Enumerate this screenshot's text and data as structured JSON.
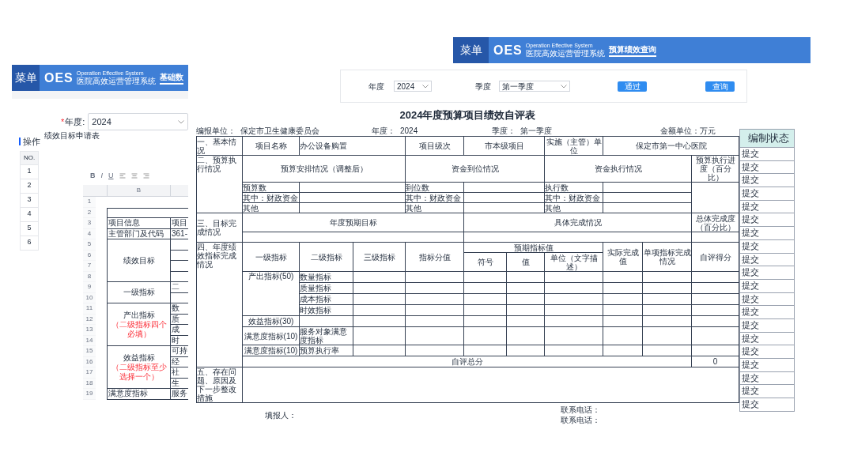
{
  "left_window": {
    "menu": "菜单",
    "logo": "OES",
    "logo_en": "Operation Effective System",
    "logo_cn": "医院高效运营管理系统",
    "tabs": [
      {
        "label": "基础数",
        "selected": true
      }
    ],
    "year_field": {
      "required_mark": "*",
      "label": "年度:",
      "value": "2024"
    },
    "section_title": "操作",
    "table": {
      "columns": [
        "NO."
      ],
      "rows": [
        "1",
        "2",
        "3",
        "4",
        "5",
        "6"
      ]
    }
  },
  "dialog": {
    "title": "绩效目标申请表",
    "toolbar": [
      "B",
      "I",
      "U"
    ],
    "sheet": {
      "column_header": "B",
      "row_numbers": [
        "1",
        "2",
        "3",
        "4",
        "5",
        "6",
        "7",
        "8",
        "9",
        "10",
        "11",
        "12",
        "13",
        "14",
        "15",
        "16",
        "17",
        "18",
        "19"
      ],
      "blocks": [
        {
          "label": "项目信息",
          "items": [
            {
              "text": "项目"
            }
          ]
        },
        {
          "label": "主管部门及代码",
          "items": [
            {
              "text": "361-"
            }
          ]
        },
        {
          "label": "绩效目标",
          "items": [
            {
              "kind": "blank"
            },
            {
              "kind": "blank"
            },
            {
              "kind": "blank"
            },
            {
              "kind": "blank"
            }
          ]
        },
        {
          "label": "一级指标",
          "items": [
            {
              "text": "二"
            },
            {
              "kind": "blank"
            }
          ]
        },
        {
          "label": "产出指标",
          "note": "（二级指标四个必填）",
          "items": [
            {
              "text": "数"
            },
            {
              "text": "质"
            },
            {
              "text": "成"
            },
            {
              "text": "时"
            }
          ]
        },
        {
          "label": "效益指标",
          "note": "（二级指标至少选择一个）",
          "items": [
            {
              "text": "可持"
            },
            {
              "text": "经"
            },
            {
              "text": "社"
            },
            {
              "text": "生"
            }
          ]
        },
        {
          "label": "满意度指标",
          "items": [
            {
              "text": "服务"
            }
          ]
        }
      ]
    }
  },
  "top_window": {
    "menu": "菜单",
    "logo": "OES",
    "logo_en": "Operation Effective System",
    "logo_cn": "医院高效运营管理系统",
    "tabs": [
      {
        "label": "预算绩效查询",
        "selected": true
      }
    ]
  },
  "filter": {
    "year_label": "年度",
    "year_value": "2024",
    "quarter_label": "季度",
    "quarter_value": "第一季度",
    "buttons": [
      "通过",
      "查询"
    ]
  },
  "form": {
    "title": "2024年度预算项目绩效自评表",
    "meta": [
      {
        "label": "编报单位：",
        "value": "保定市卫生健康委员会"
      },
      {
        "label": "年度：",
        "value": "2024"
      },
      {
        "label": "季度：",
        "value": "第一季度"
      },
      {
        "label": "金额单位：万元"
      }
    ],
    "rows": [
      [
        {
          "text": "一、基本情况"
        },
        {
          "text": "项目名称"
        },
        {
          "text": "办公设备购置",
          "colspan": 2
        },
        {
          "text": "项目级次"
        },
        {
          "text": "市本级项目",
          "colspan": 2
        },
        {
          "text": "实施（主管）单位"
        },
        {
          "text": "保定市第一中心医院",
          "colspan": 3
        }
      ],
      [
        {
          "text": "二、预算执行情况",
          "rowspan": 4
        },
        {
          "text": "预算安排情况（调整后）",
          "colspan": 3
        },
        {
          "text": "资金到位情况",
          "colspan": 3
        },
        {
          "text": "资金执行情况",
          "colspan": 3
        },
        {
          "text": "预算执行进度（百分比）"
        }
      ],
      [
        {
          "text": "预算数"
        },
        {
          "colspan": 2
        },
        {
          "text": "到位数"
        },
        {
          "colspan": 2
        },
        {
          "text": "执行数"
        },
        {
          "colspan": 2
        },
        {
          "rowspan": 3
        }
      ],
      [
        {
          "text": "其中：财政资金"
        },
        {
          "colspan": 2
        },
        {
          "text": "其中：财政资金"
        },
        {
          "colspan": 2
        },
        {
          "text": "其中：财政资金"
        },
        {
          "colspan": 2
        }
      ],
      [
        {
          "text": "其他"
        },
        {
          "colspan": 2
        },
        {
          "text": "其他"
        },
        {
          "colspan": 2
        },
        {
          "text": "其他"
        },
        {
          "colspan": 2
        }
      ],
      [
        {
          "text": "三、目标完成情况",
          "rowspan": 2
        },
        {
          "text": "年度预期目标",
          "colspan": 4
        },
        {
          "text": "具体完成情况",
          "colspan": 5
        },
        {
          "text": "总体完成度（百分比）"
        }
      ],
      [
        {
          "colspan": 4
        },
        {
          "colspan": 5
        },
        {}
      ],
      [
        {
          "text": "四、年度绩效指标完成情况",
          "rowspan": 10
        },
        {
          "text": "一级指标",
          "rowspan": 2
        },
        {
          "text": "二级指标",
          "rowspan": 2
        },
        {
          "text": "三级指标",
          "rowspan": 2
        },
        {
          "text": "指标分值",
          "rowspan": 2
        },
        {
          "text": "预期指标值",
          "colspan": 3
        },
        {
          "text": "实际完成值",
          "rowspan": 2
        },
        {
          "text": "单项指标完成情况",
          "rowspan": 2
        },
        {
          "text": "自评得分",
          "rowspan": 2
        }
      ],
      [
        {
          "text": "符号"
        },
        {
          "text": "值"
        },
        {
          "text": "单位（文字描述）"
        }
      ],
      [
        {
          "text": "产出指标(50)",
          "rowspan": 4
        },
        {
          "text": "数量指标"
        },
        {},
        {},
        {},
        {},
        {},
        {},
        {},
        {}
      ],
      [
        {
          "text": "质量指标"
        },
        {},
        {},
        {},
        {},
        {},
        {},
        {},
        {}
      ],
      [
        {
          "text": "成本指标"
        },
        {},
        {},
        {},
        {},
        {},
        {},
        {},
        {}
      ],
      [
        {
          "text": "时效指标"
        },
        {},
        {},
        {},
        {},
        {},
        {},
        {},
        {}
      ],
      [
        {
          "text": "效益指标(30)"
        },
        {},
        {},
        {},
        {},
        {},
        {},
        {},
        {},
        {}
      ],
      [
        {
          "text": "满意度指标(10)"
        },
        {
          "text": "服务对象满意度指标"
        },
        {},
        {},
        {},
        {},
        {},
        {},
        {},
        {}
      ],
      [
        {
          "text": "满意度指标(10)"
        },
        {
          "text": "预算执行率"
        },
        {},
        {},
        {},
        {},
        {},
        {},
        {},
        {}
      ],
      [
        {
          "text": "自评总分",
          "colspan": 9
        },
        {
          "text": "0"
        }
      ],
      [
        {
          "text": "五、存在问题、原因及下一步整改措施"
        },
        {
          "colspan": 10
        }
      ]
    ],
    "footer": {
      "filler": "填报人：",
      "phones": [
        "联系电话：",
        "联系电话："
      ]
    }
  },
  "status_table": {
    "column": "编制状态",
    "rows": [
      "提交",
      "提交",
      "提交",
      "提交",
      "提交",
      "提交",
      "提交",
      "提交",
      "提交",
      "提交",
      "提交",
      "提交",
      "提交",
      "提交",
      "提交",
      "提交",
      "提交",
      "提交",
      "提交",
      "提交"
    ]
  }
}
